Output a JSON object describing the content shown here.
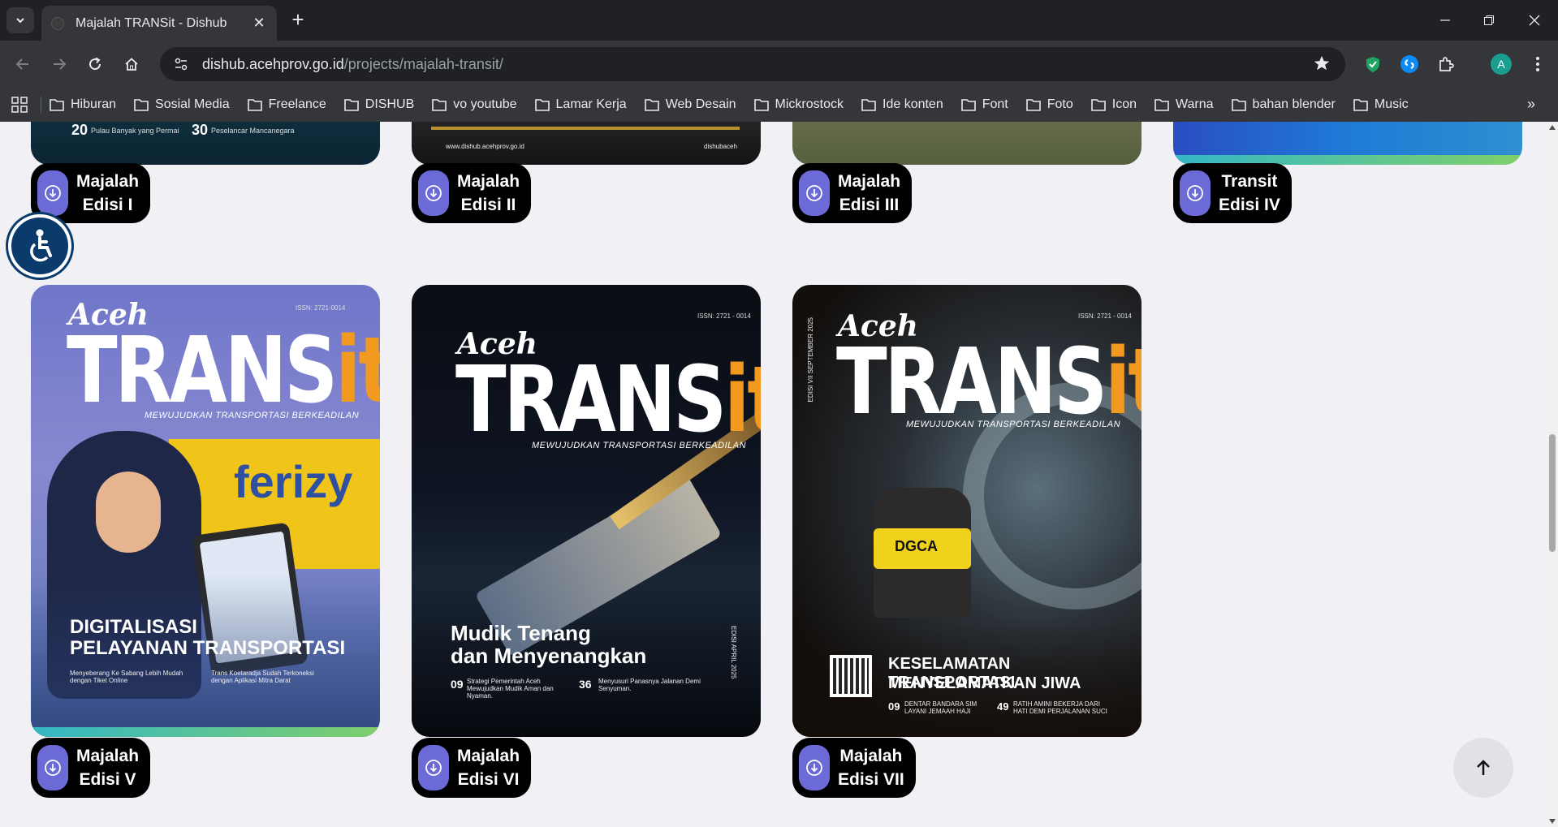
{
  "browser": {
    "tab_title": "Majalah TRANSit - Dishub",
    "url_host": "dishub.acehprov.go.id",
    "url_path": "/projects/majalah-transit/",
    "avatar_letter": "A",
    "bookmarks": [
      "Hiburan",
      "Sosial Media",
      "Freelance",
      "DISHUB",
      "vo youtube",
      "Lamar Kerja",
      "Web Desain",
      "Mickrostock",
      "Ide konten",
      "Font",
      "Foto",
      "Icon",
      "Warna",
      "bahan blender",
      "Music"
    ]
  },
  "top_row": [
    {
      "line1": "Majalah",
      "line2": "Edisi I",
      "snippet_a": "20",
      "snippet_b": "Pulau Banyak yang Permai",
      "snippet_c": "30",
      "snippet_d": "Peselancar Mancanegara"
    },
    {
      "line1": "Majalah",
      "line2": "Edisi II",
      "snippet_a": "www.dishub.acehprov.go.id",
      "snippet_b": "dishubaceh"
    },
    {
      "line1": "Majalah",
      "line2": "Edisi III"
    },
    {
      "line1": "Transit",
      "line2": "Edisi IV"
    }
  ],
  "magazines": [
    {
      "line1": "Majalah",
      "line2": "Edisi V",
      "issn": "ISSN: 2721-0014",
      "aceh": "Aceh",
      "brand_main": "TRANS",
      "brand_it": "it",
      "tagline": "MEWUJUDKAN TRANSPORTASI BERKEADILAN",
      "headline1": "DIGITALISASI",
      "headline2": "PELAYANAN TRANSPORTASI",
      "foot1": "Menyeberang Ke Sabang Lebih Mudah dengan Tiket Online",
      "foot2": "Trans Koetaradja Sudah Terkoneksi dengan Aplikasi Mitra Darat"
    },
    {
      "line1": "Majalah",
      "line2": "Edisi VI",
      "issn": "ISSN: 2721 - 0014",
      "aceh": "Aceh",
      "brand_main": "TRANS",
      "brand_it": "it",
      "tagline": "MEWUJUDKAN TRANSPORTASI BERKEADILAN",
      "headline1": "Mudik Tenang",
      "headline2": "dan Menyenangkan",
      "foot_num1": "09",
      "foot1": "Strategi Pemerintah Aceh Mewujudkan Mudik Aman dan Nyaman.",
      "foot_num2": "36",
      "foot2": "Menyusuri Panasnya Jalanan Demi Senyuman.",
      "edition_side": "EDISI APRIL 2025"
    },
    {
      "line1": "Majalah",
      "line2": "Edisi VII",
      "issn": "ISSN: 2721 - 0014",
      "aceh": "Aceh",
      "brand_main": "TRANS",
      "brand_it": "it",
      "tagline": "MEWUJUDKAN TRANSPORTASI BERKEADILAN",
      "headline1": "KESELAMATAN TRANSPORTASI",
      "headline2": "MENYELAMATKAN JIWA",
      "foot_num1": "09",
      "foot1": "DENTAR BANDARA SIM LAYANI JEMAAH HAJI",
      "foot_num2": "49",
      "foot2": "RATIH AMINI BEKERJA DARI HATI DEMI PERJALANAN SUCI",
      "vest_text": "DGCA",
      "edition_side": "EDISI VII SEPTEMBER 2025"
    }
  ],
  "colors": {
    "accent": "#6b6ad6",
    "brand_orange": "#f29a1f",
    "accessibility_blue": "#0a3b6a"
  }
}
